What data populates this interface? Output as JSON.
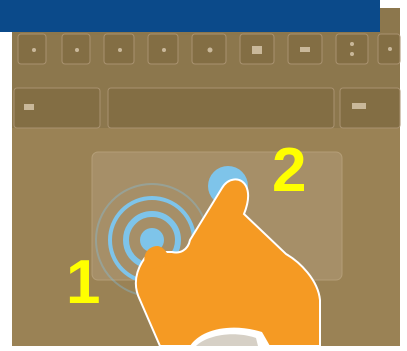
{
  "banner": {
    "color": "#0b4a8a"
  },
  "steps": {
    "first": "1",
    "second": "2",
    "color": "#ffff00"
  },
  "touch_rings": {
    "color": "#7ec4ea"
  },
  "hand": {
    "color": "#f59a23"
  },
  "laptop": {
    "body_color": "#9a8255",
    "keys_color": "#8a7549",
    "trackpad_color": "#a68f68"
  },
  "icons": [
    "two-finger-tap-hand-icon",
    "touch-ripple-icon",
    "trackpad-icon",
    "keyboard-icon"
  ]
}
